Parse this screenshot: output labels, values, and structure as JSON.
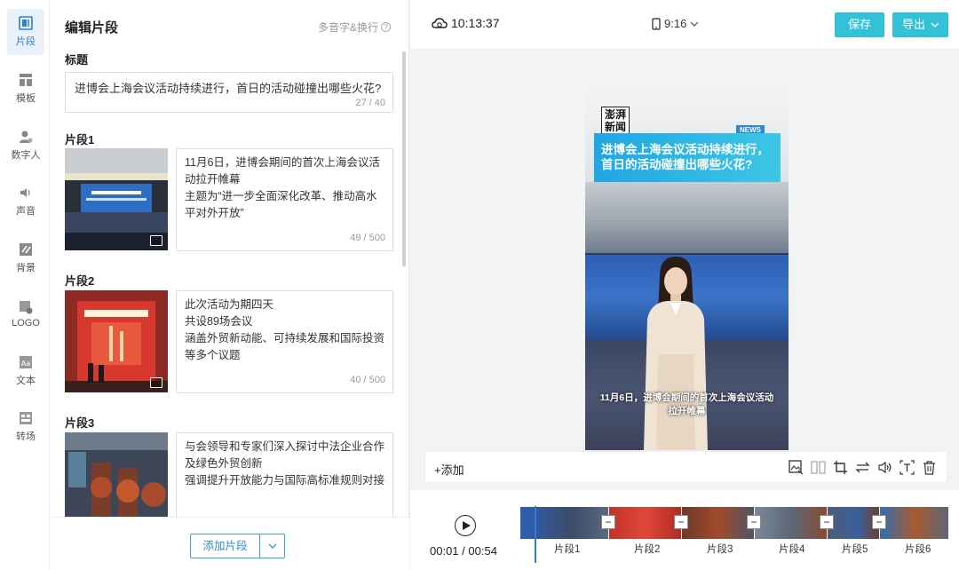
{
  "rail": {
    "items": [
      {
        "label": "片段",
        "icon": "clip-icon",
        "active": true
      },
      {
        "label": "模板",
        "icon": "template-icon"
      },
      {
        "label": "数字人",
        "icon": "digital-human-icon"
      },
      {
        "label": "声音",
        "icon": "sound-icon"
      },
      {
        "label": "背景",
        "icon": "background-icon"
      },
      {
        "label": "LOGO",
        "icon": "logo-icon"
      },
      {
        "label": "文本",
        "icon": "text-icon"
      },
      {
        "label": "转场",
        "icon": "transition-icon"
      }
    ]
  },
  "panel": {
    "title": "编辑片段",
    "help": "多音字&换行",
    "title_label": "标题",
    "title_value": "进博会上海会议活动持续进行，首日的活动碰撞出哪些火花?",
    "title_counter": "27 / 40",
    "segments": [
      {
        "label": "片段1",
        "lines": [
          "11月6日，进博会期间的首次上海会议活",
          "动拉开帷幕",
          "主题为“进一步全面深化改革、推动高水",
          "平对外开放”"
        ],
        "counter": "49 / 500"
      },
      {
        "label": "片段2",
        "lines": [
          "此次活动为期四天",
          "共设89场会议",
          "涵盖外贸新动能、可持续发展和国际投资",
          "等多个议题"
        ],
        "counter": "40 / 500"
      },
      {
        "label": "片段3",
        "lines": [
          "与会领导和专家们深入探讨中法企业合作",
          "及绿色外贸创新",
          "强调提升开放能力与国际高标准规则对接"
        ],
        "counter": ""
      }
    ],
    "add_button": "添加片段"
  },
  "topbar": {
    "time": "10:13:37",
    "ratio": "9:16",
    "save": "保存",
    "export": "导出"
  },
  "preview": {
    "logo_text": "澎湃新闻",
    "news_tag": "NEWS",
    "title_lines": [
      "进博会上海会议活动持续进行，",
      "首日的活动碰撞出哪些火花?"
    ],
    "caption_lines": [
      "11月6日，进博会期间的首次上海会议活动",
      "拉开帷幕"
    ]
  },
  "toolbar": {
    "add": "+添加"
  },
  "timeline": {
    "current": "00:01",
    "total": "00:54",
    "separator": " / ",
    "clips": [
      "片段1",
      "片段2",
      "片段3",
      "片段4",
      "片段5",
      "片段6"
    ]
  }
}
